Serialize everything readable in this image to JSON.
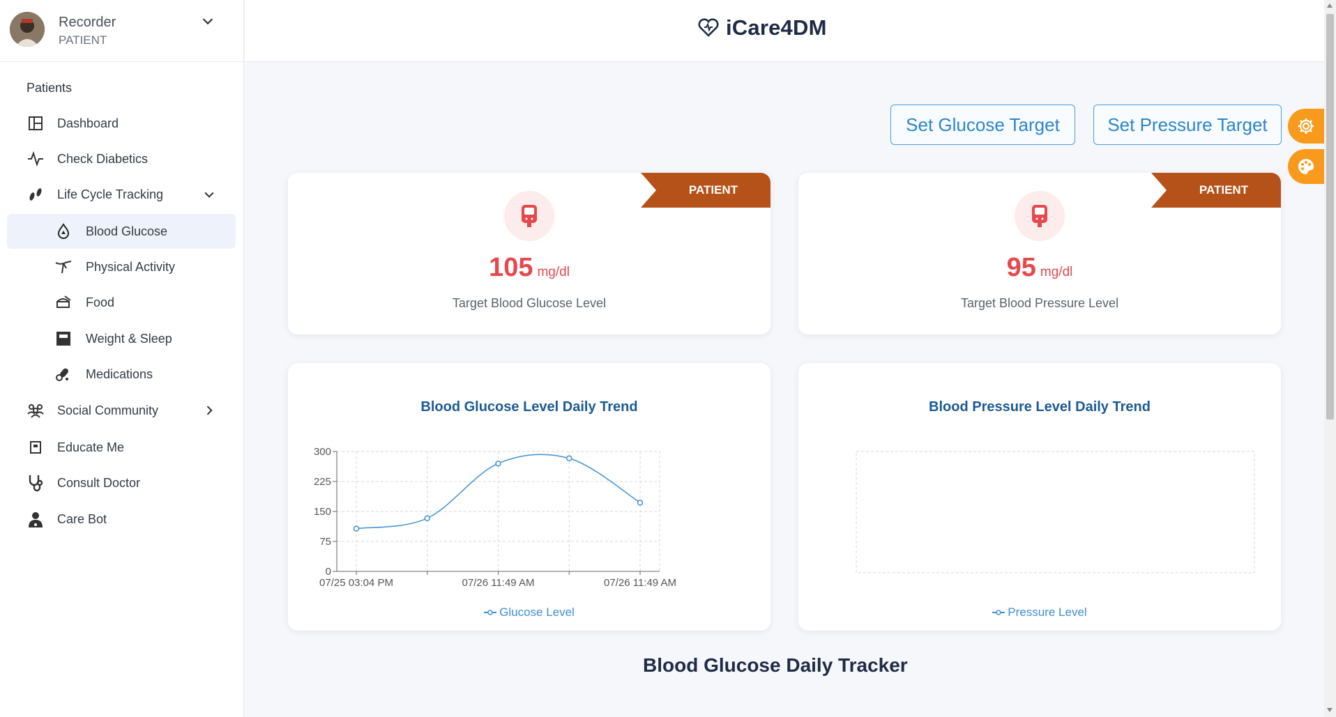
{
  "user": {
    "name": "Recorder",
    "role": "PATIENT"
  },
  "sidebar": {
    "section": "Patients",
    "items": [
      {
        "label": "Dashboard"
      },
      {
        "label": "Check Diabetics"
      },
      {
        "label": "Life Cycle Tracking"
      },
      {
        "label": "Blood Glucose"
      },
      {
        "label": "Physical Activity"
      },
      {
        "label": "Food"
      },
      {
        "label": "Weight & Sleep"
      },
      {
        "label": "Medications"
      },
      {
        "label": "Social Community"
      },
      {
        "label": "Educate Me"
      },
      {
        "label": "Consult Doctor"
      },
      {
        "label": "Care Bot"
      }
    ]
  },
  "header": {
    "title": "iCare4DM"
  },
  "actions": {
    "glucose_target": "Set Glucose Target",
    "pressure_target": "Set Pressure Target"
  },
  "targets": {
    "glucose": {
      "badge": "PATIENT",
      "value": "105",
      "unit": "mg/dl",
      "label": "Target Blood Glucose Level"
    },
    "pressure": {
      "badge": "PATIENT",
      "value": "95",
      "unit": "mg/dl",
      "label": "Target Blood Pressure Level"
    }
  },
  "charts": {
    "glucose": {
      "title": "Blood Glucose Level Daily Trend",
      "legend": "Glucose Level"
    },
    "pressure": {
      "title": "Blood Pressure Level Daily Trend",
      "legend": "Pressure Level"
    }
  },
  "tracker": {
    "title": "Blood Glucose Daily Tracker"
  },
  "colors": {
    "accent": "#2c86c8",
    "badge": "#b5521a",
    "target": "#e5484d",
    "float": "#f89a1c"
  },
  "chart_data": [
    {
      "type": "line",
      "title": "Blood Glucose Level Daily Trend",
      "x": [
        "07/25 03:04 PM",
        "",
        "07/26 11:49 AM",
        "",
        "07/26 11:49 AM"
      ],
      "series": [
        {
          "name": "Glucose Level",
          "values": [
            107,
            133,
            270,
            283,
            172
          ]
        }
      ],
      "yticks": [
        0,
        75,
        150,
        225,
        300
      ],
      "ylim": [
        0,
        300
      ],
      "grid": true,
      "legend": "bottom"
    },
    {
      "type": "line",
      "title": "Blood Pressure Level Daily Trend",
      "x": [],
      "series": [
        {
          "name": "Pressure Level",
          "values": []
        }
      ],
      "grid": true,
      "legend": "bottom"
    }
  ]
}
